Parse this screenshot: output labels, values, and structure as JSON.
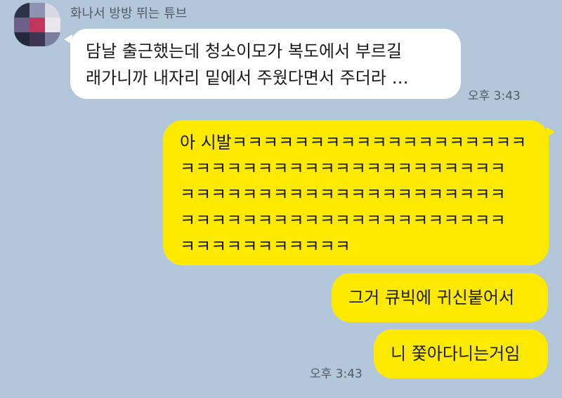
{
  "sender": {
    "name": "화나서 방방 뛰는 튜브",
    "avatar_colors": [
      "#3a3f56",
      "#6c5f88",
      "#d9d9e4",
      "#c0355a",
      "#24283b",
      "#8d93b0"
    ]
  },
  "messages": [
    {
      "direction": "incoming",
      "lines": [
        "담날 출근했는데 청소이모가 복도에서 부르길",
        "래가니까 내자리 밑에서 주웠다면서 주더라 …"
      ],
      "time": "오후 3:43"
    },
    {
      "direction": "outgoing",
      "lines": [
        "아 시발ㅋㅋㅋㅋㅋㅋㅋㅋㅋㅋㅋㅋㅋㅋㅋㅋㅋㅋㅋ",
        "ㅋㅋㅋㅋㅋㅋㅋㅋㅋㅋㅋㅋㅋㅋㅋㅋㅋㅋㅋㅋㅋ",
        "ㅋㅋㅋㅋㅋㅋㅋㅋㅋㅋㅋㅋㅋㅋㅋㅋㅋㅋㅋㅋㅋ",
        "ㅋㅋㅋㅋㅋㅋㅋㅋㅋㅋㅋㅋㅋㅋㅋㅋㅋㅋㅋㅋㅋ",
        "ㅋㅋㅋㅋㅋㅋㅋㅋㅋㅋㅋ"
      ]
    },
    {
      "direction": "outgoing",
      "text": "그거 큐빅에 귀신붙어서"
    },
    {
      "direction": "outgoing",
      "text": "니 쫓아다니는거임",
      "time": "오후 3:43"
    }
  ],
  "theme": {
    "background": "#b2c7da",
    "incoming_bubble": "#ffffff",
    "outgoing_bubble": "#fdea00"
  }
}
